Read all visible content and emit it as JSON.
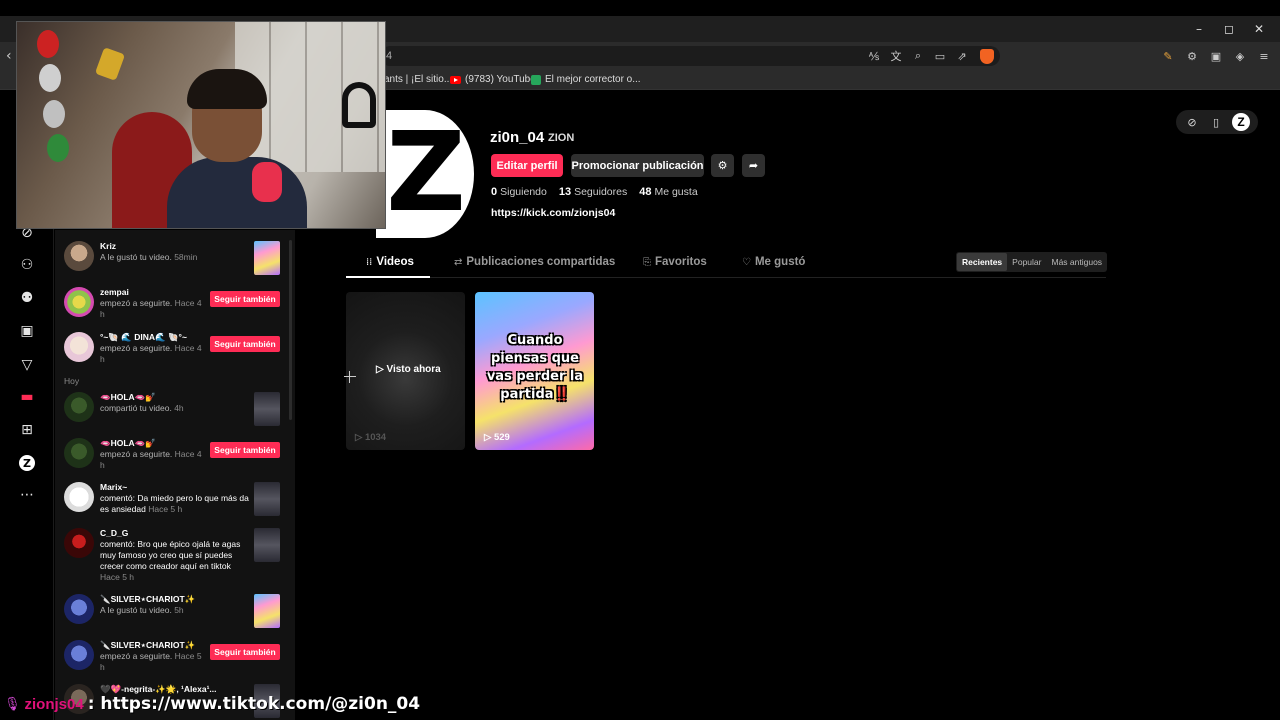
{
  "browser": {
    "url_fragment": "4",
    "bookmarks": [
      {
        "label": "ants | ¡El sitio..."
      },
      {
        "label": "(9783) YouTube"
      },
      {
        "label": "El mejor corrector o..."
      }
    ],
    "window_controls": {
      "minimize": "–",
      "maximize": "◻",
      "close": "✕"
    }
  },
  "profile": {
    "username": "zi0n_04",
    "nickname": "ZION",
    "edit_label": "Editar perfil",
    "promote_label": "Promocionar publicación",
    "stats": {
      "following_count": "0",
      "following_label": "Siguiendo",
      "followers_count": "13",
      "followers_label": "Seguidores",
      "likes_count": "48",
      "likes_label": "Me gusta"
    },
    "bio_link": "https://kick.com/zionjs04"
  },
  "tabs": [
    {
      "label": "Videos",
      "icon": "grid-icon"
    },
    {
      "label": "Publicaciones compartidas",
      "icon": "repost-icon"
    },
    {
      "label": "Favoritos",
      "icon": "bookmark-icon"
    },
    {
      "label": "Me gustó",
      "icon": "heart-outline-icon"
    }
  ],
  "sort": {
    "options": [
      "Recientes",
      "Popular",
      "Más antiguos"
    ],
    "selected": "Recientes"
  },
  "videos": [
    {
      "overlay": "Visto ahora",
      "views": "1034"
    },
    {
      "caption": "Cuando piensas que vas perder la partida‼️",
      "views": "529"
    }
  ],
  "activity": {
    "section_today": "Hoy",
    "follow_back_label": "Seguir también",
    "items": [
      {
        "user": "Kriz",
        "text": "A le gustó tu video.",
        "time": "58min"
      },
      {
        "user": "zempai",
        "text": "empezó a seguirte.",
        "time": "Hace 4 h"
      },
      {
        "user": "°~🐚 🌊 DINA🌊 🐚°~",
        "text": "empezó a seguirte.",
        "time": "Hace 4 h"
      },
      {
        "user": "🫦HOLA🫦💅",
        "text": "compartió tu video.",
        "time": "4h"
      },
      {
        "user": "🫦HOLA🫦💅",
        "text": "empezó a seguirte.",
        "time": "Hace 4 h"
      },
      {
        "user": "Marix~",
        "text": "comentó: Da miedo pero lo que más da es ansiedad",
        "time": "Hace 5 h"
      },
      {
        "user": "C_D_G",
        "text": "comentó: Bro que épico ojalá te agas muy famoso yo creo que sí puedes crecer como creador aquí en tiktok",
        "time": "Hace 5 h"
      },
      {
        "user": "🔪SILVER⋆CHARIOT✨",
        "text": "A le gustó tu video.",
        "time": "5h"
      },
      {
        "user": "🔪SILVER⋆CHARIOT✨",
        "text": "empezó a seguirte.",
        "time": "Hace 5 h"
      },
      {
        "user": "🖤💖-negrita-✨🌟, ¹Alexa¹..."
      }
    ]
  },
  "stream_overlay": {
    "channel": "zionjs04",
    "link": ": https://www.tiktok.com/@zi0n_04"
  }
}
